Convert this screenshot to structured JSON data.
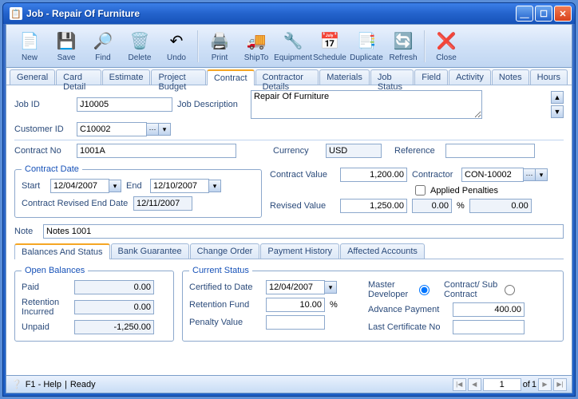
{
  "window": {
    "title": "Job - Repair Of Furniture"
  },
  "toolbar": {
    "new": "New",
    "save": "Save",
    "find": "Find",
    "delete": "Delete",
    "undo": "Undo",
    "print": "Print",
    "shipto": "ShipTo",
    "equipment": "Equipment",
    "schedule": "Schedule",
    "duplicate": "Duplicate",
    "refresh": "Refresh",
    "close": "Close"
  },
  "tabs": [
    "General",
    "Card Detail",
    "Estimate",
    "Project Budget",
    "Contract",
    "Contractor Details",
    "Materials",
    "Job Status",
    "Field",
    "Activity",
    "Notes",
    "Hours"
  ],
  "active_tab": 4,
  "form": {
    "job_id_lbl": "Job ID",
    "job_id": "J10005",
    "job_desc_lbl": "Job Description",
    "job_desc": "Repair Of Furniture",
    "customer_id_lbl": "Customer ID",
    "customer_id": "C10002",
    "contract_no_lbl": "Contract No",
    "contract_no": "1001A",
    "currency_lbl": "Currency",
    "currency": "USD",
    "reference_lbl": "Reference",
    "reference": "",
    "contract_date_legend": "Contract Date",
    "start_lbl": "Start",
    "start": "12/04/2007",
    "end_lbl": "End",
    "end": "12/10/2007",
    "revised_end_lbl": "Contract Revised End Date",
    "revised_end": "12/11/2007",
    "contract_value_lbl": "Contract Value",
    "contract_value": "1,200.00",
    "revised_value_lbl": "Revised Value",
    "revised_value": "1,250.00",
    "contractor_lbl": "Contractor",
    "contractor": "CON-10002",
    "applied_penalties_lbl": "Applied Penalties",
    "penalty_amt": "0.00",
    "penalty_pct": "%",
    "penalty_val2": "0.00",
    "note_lbl": "Note",
    "note": "Notes 1001"
  },
  "subtabs": [
    "Balances And Status",
    "Bank Guarantee",
    "Change Order",
    "Payment History",
    "Affected Accounts"
  ],
  "active_subtab": 0,
  "open_balances": {
    "legend": "Open Balances",
    "paid_lbl": "Paid",
    "paid": "0.00",
    "retention_lbl": "Retention Incurred",
    "retention": "0.00",
    "unpaid_lbl": "Unpaid",
    "unpaid": "-1,250.00"
  },
  "current_status": {
    "legend": "Current Status",
    "certified_lbl": "Certified to Date",
    "certified": "12/04/2007",
    "retention_fund_lbl": "Retention Fund",
    "retention_fund": "10.00",
    "pct": "%",
    "penalty_value_lbl": "Penalty Value",
    "penalty_value": "",
    "master_dev_lbl": "Master Developer",
    "subcontract_lbl": "Contract/ Sub Contract",
    "advance_lbl": "Advance Payment",
    "advance": "400.00",
    "lastcert_lbl": "Last Certificate No",
    "lastcert": ""
  },
  "statusbar": {
    "help": "F1 - Help",
    "ready": "Ready",
    "page": "1",
    "of": "of",
    "total": "1"
  }
}
